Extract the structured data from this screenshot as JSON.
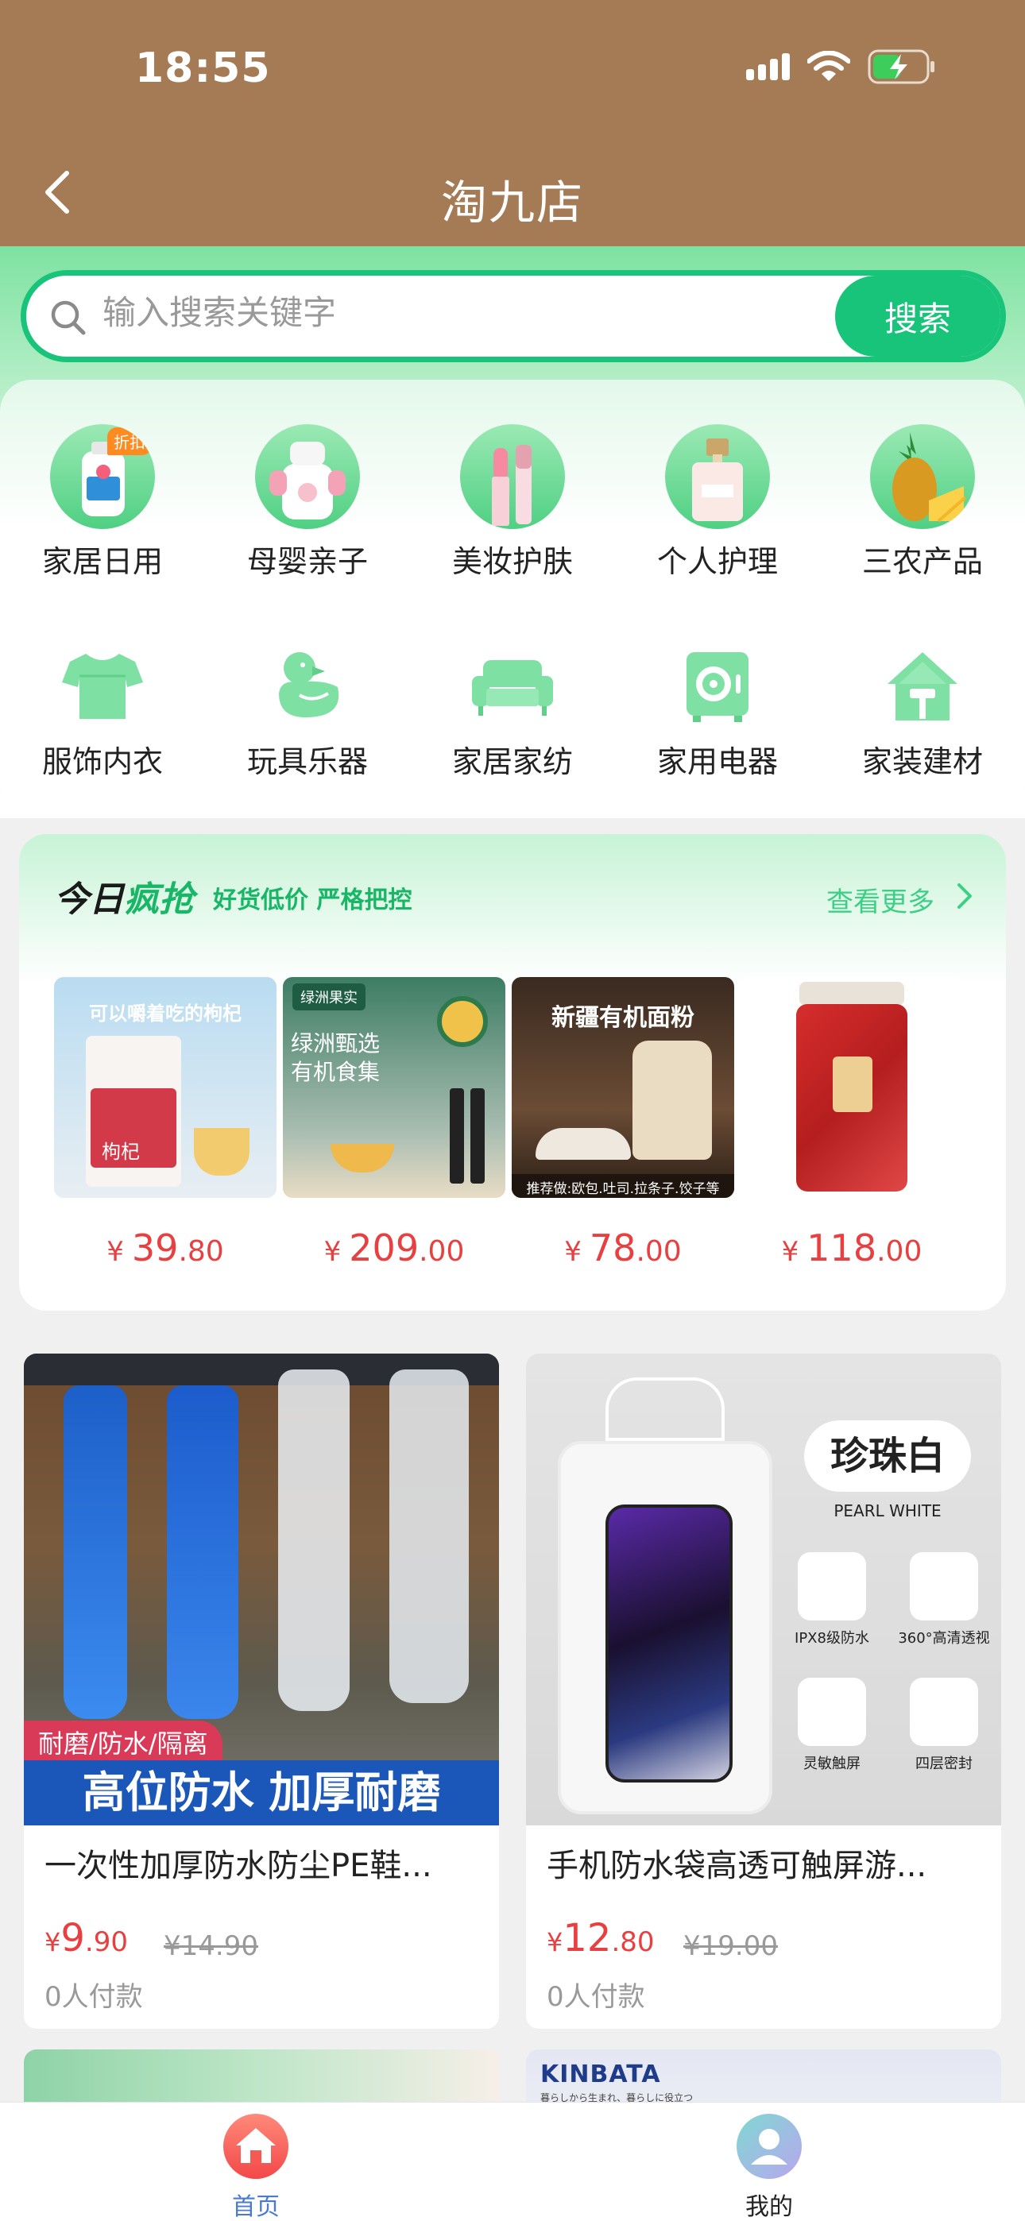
{
  "status_bar": {
    "time": "18:55"
  },
  "header": {
    "title": "淘九店"
  },
  "search": {
    "placeholder": "输入搜索关键字",
    "button_label": "搜索"
  },
  "categories": [
    {
      "label": "家居日用",
      "badge": "折扣"
    },
    {
      "label": "母婴亲子"
    },
    {
      "label": "美妆护肤"
    },
    {
      "label": "个人护理"
    },
    {
      "label": "三农产品"
    },
    {
      "label": "服饰内衣",
      "icon": "shirt-icon"
    },
    {
      "label": "玩具乐器",
      "icon": "duck-icon"
    },
    {
      "label": "家居家纺",
      "icon": "sofa-icon"
    },
    {
      "label": "家用电器",
      "icon": "appliance-icon"
    },
    {
      "label": "家装建材",
      "icon": "house-icon"
    }
  ],
  "flash_sale": {
    "title_a": "今日",
    "title_b": "疯抢",
    "subtitle": "好货低价 严格把控",
    "see_more": "查看更多",
    "items": [
      {
        "price_int": "39",
        "price_dec": ".80",
        "img_text": "可以嚼着吃的枸杞",
        "img_sub": "枸杞"
      },
      {
        "price_int": "209",
        "price_dec": ".00",
        "img_text": "绿洲甄选 有机食集",
        "img_tag": "绿洲果实"
      },
      {
        "price_int": "78",
        "price_dec": ".00",
        "img_text": "新疆有机面粉",
        "img_sub": "推荐做:欧包.吐司.拉条子.饺子等"
      },
      {
        "price_int": "118",
        "price_dec": ".00"
      }
    ],
    "currency": "¥"
  },
  "products": [
    {
      "name": "一次性加厚防水防尘PE鞋...",
      "price_int": "9",
      "price_dec": ".90",
      "old_price": "¥14.90",
      "paid": "0人付款",
      "banner_tag": "耐磨/防水/隔离",
      "banner_main": "高位防水 加厚耐磨"
    },
    {
      "name": "手机防水袋高透可触屏游...",
      "price_int": "12",
      "price_dec": ".80",
      "old_price": "¥19.00",
      "paid": "0人付款",
      "img_title": "珍珠白",
      "img_en": "PEARL WHITE",
      "features": [
        "IPX8级防水",
        "360°高清透视",
        "灵敏触屏",
        "四层密封"
      ]
    }
  ],
  "peek": {
    "brand": "KINBATA",
    "brand_sub": "暮らしから生まれ、暮らしに役立つ"
  },
  "bottom_nav": [
    {
      "label": "首页",
      "active": true
    },
    {
      "label": "我的",
      "active": false
    }
  ],
  "colors": {
    "header": "#a57b55",
    "accent": "#17c47a",
    "price": "#e84040"
  }
}
